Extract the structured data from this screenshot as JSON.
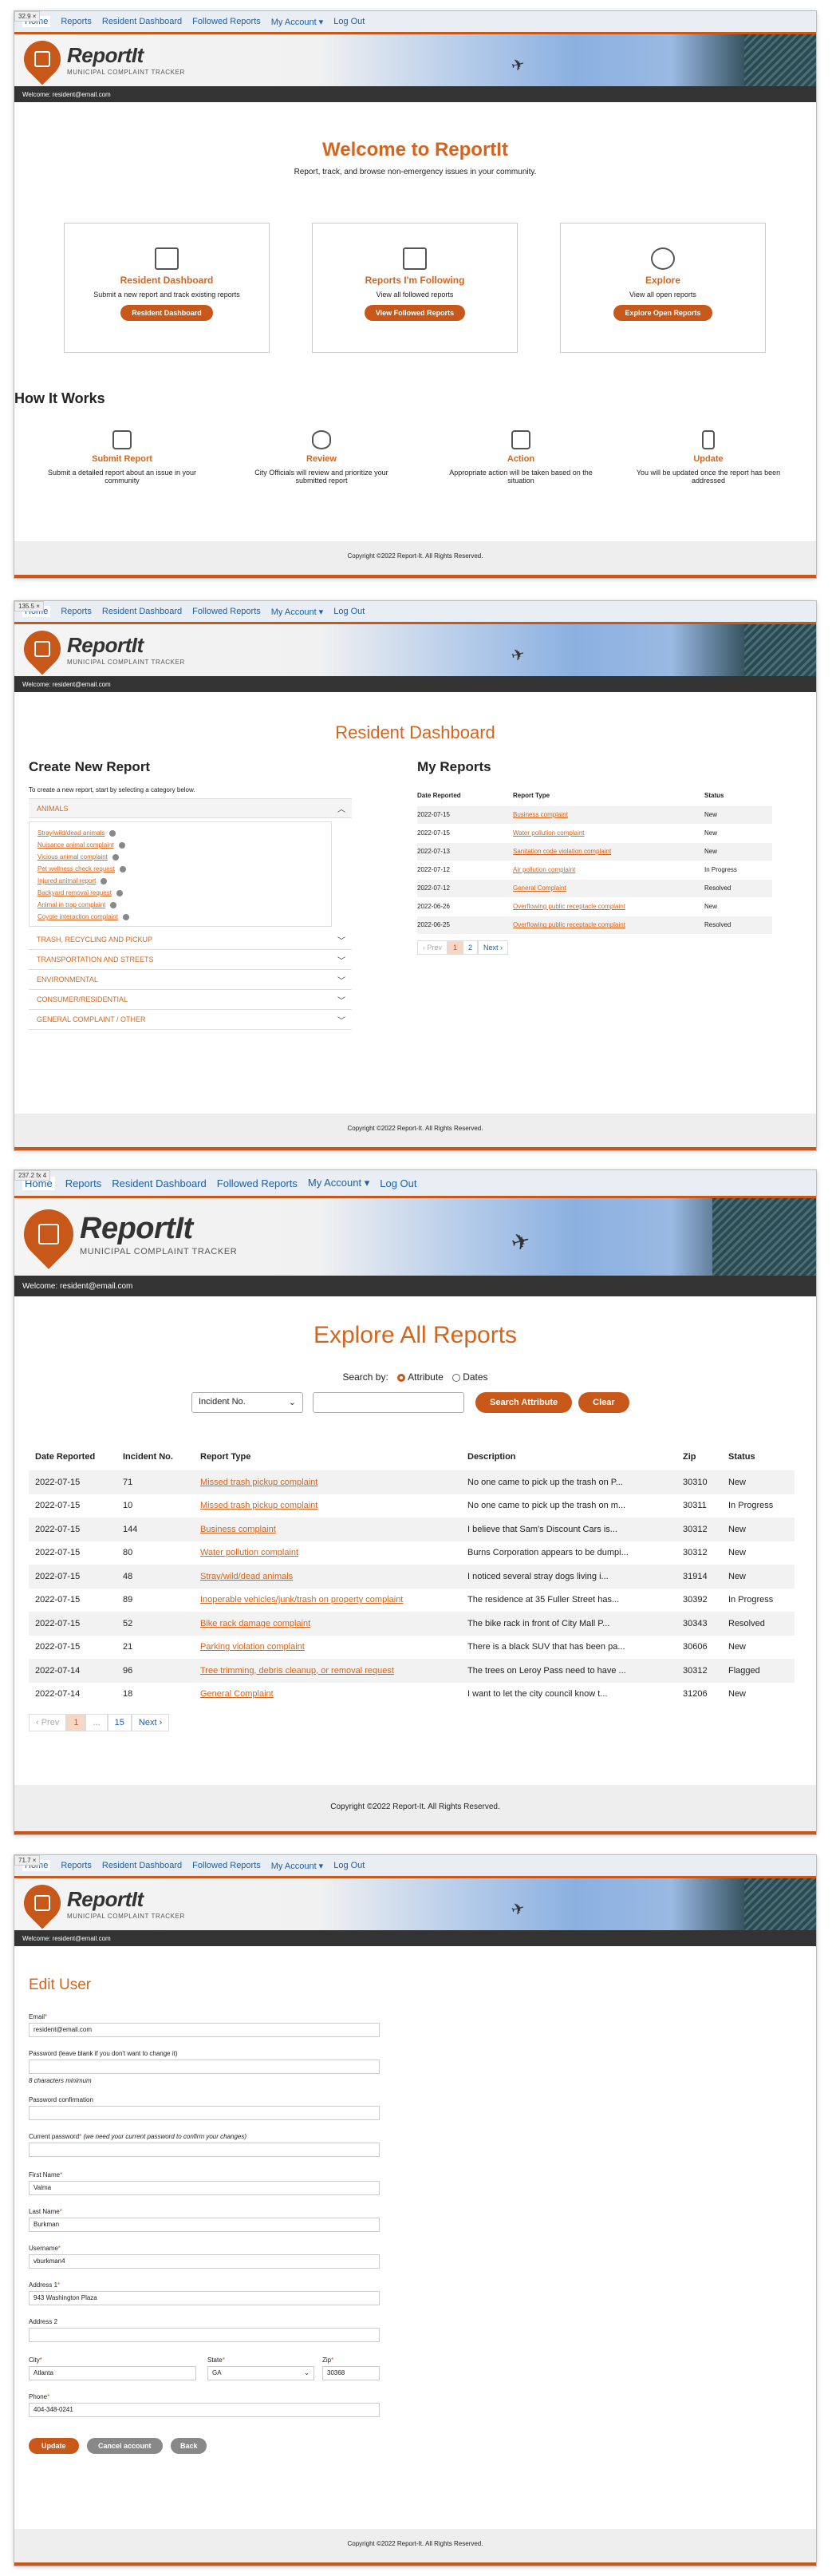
{
  "common": {
    "nav": [
      "Home",
      "Reports",
      "Resident Dashboard",
      "Followed Reports",
      "My Account",
      "Log Out"
    ],
    "logo_title": "ReportIt",
    "logo_subtitle": "MUNICIPAL COMPLAINT TRACKER",
    "welcome": "Welcome: resident@email.com",
    "copyright": "Copyright ©2022 Report-It. All Rights Reserved.",
    "colors": {
      "accent": "#c8581a",
      "link": "#1c5fa8",
      "bar": "#333333"
    }
  },
  "shot_tags": [
    "32.9 ×",
    "135.5 ×",
    "237.2 fx 4",
    "71.7 ×"
  ],
  "home": {
    "title": "Welcome to ReportIt",
    "subtitle": "Report, track, and browse non-emergency issues in your community.",
    "cards": [
      {
        "title": "Resident Dashboard",
        "text": "Submit a new report and track existing reports",
        "button": "Resident Dashboard",
        "icon": "dashboard-icon"
      },
      {
        "title": "Reports I'm Following",
        "text": "View all followed reports",
        "button": "View Followed Reports",
        "icon": "followed-icon"
      },
      {
        "title": "Explore",
        "text": "View all open reports",
        "button": "Explore Open Reports",
        "icon": "compass-icon"
      }
    ],
    "how_title": "How It Works",
    "steps": [
      {
        "title": "Submit Report",
        "text": "Submit a detailed report about an issue in your community",
        "icon": "envelope-icon"
      },
      {
        "title": "Review",
        "text": "City Officials will review and prioritize your submitted report",
        "icon": "eye-icon"
      },
      {
        "title": "Action",
        "text": "Appropriate action will be taken based on the situation",
        "icon": "clipboard-icon"
      },
      {
        "title": "Update",
        "text": "You will be updated once the report has been addressed",
        "icon": "phone-icon"
      }
    ]
  },
  "dashboard": {
    "title": "Resident Dashboard",
    "create_title": "Create New Report",
    "create_intro": "To create a new report, start by selecting a category below.",
    "categories": [
      "ANIMALS",
      "TRASH, RECYCLING AND PICKUP",
      "TRANSPORTATION AND STREETS",
      "ENVIRONMENTAL",
      "CONSUMER/RESIDENTIAL",
      "GENERAL COMPLAINT / OTHER"
    ],
    "animal_items": [
      "Stray/wild/dead animals",
      "Nuisance animal complaint",
      "Vicious animal complaint",
      "Pet wellness check request",
      "Injured animal report",
      "Backyard removal request",
      "Animal in trap complaint",
      "Coyote interaction complaint"
    ],
    "my_reports_title": "My Reports",
    "headers": [
      "Date Reported",
      "Report Type",
      "Status"
    ],
    "rows": [
      [
        "2022-07-15",
        "Business complaint",
        "New"
      ],
      [
        "2022-07-15",
        "Water pollution complaint",
        "New"
      ],
      [
        "2022-07-13",
        "Sanitation code violation complaint",
        "New"
      ],
      [
        "2022-07-12",
        "Air pollution complaint",
        "In Progress"
      ],
      [
        "2022-07-12",
        "General Complaint",
        "Resolved"
      ],
      [
        "2022-06-26",
        "Overflowing public receptacle complaint",
        "New"
      ],
      [
        "2022-06-25",
        "Overflowing public receptacle complaint",
        "Resolved"
      ]
    ],
    "pagination": [
      "‹ Prev",
      "1",
      "2",
      "Next ›"
    ]
  },
  "explore": {
    "title": "Explore All Reports",
    "search_by": "Search by:",
    "radio_attr": "Attribute",
    "radio_dates": "Dates",
    "select_value": "Incident No.",
    "search_button": "Search Attribute",
    "clear_button": "Clear",
    "headers": [
      "Date Reported",
      "Incident No.",
      "Report Type",
      "Description",
      "Zip",
      "Status"
    ],
    "rows": [
      [
        "2022-07-15",
        "71",
        "Missed trash pickup complaint",
        "No one came to pick up the trash on P...",
        "30310",
        "New"
      ],
      [
        "2022-07-15",
        "10",
        "Missed trash pickup complaint",
        "No one came to pick up the trash on m...",
        "30311",
        "In Progress"
      ],
      [
        "2022-07-15",
        "144",
        "Business complaint",
        "I believe that Sam's Discount Cars is...",
        "30312",
        "New"
      ],
      [
        "2022-07-15",
        "80",
        "Water pollution complaint",
        "Burns Corporation appears to be dumpi...",
        "30312",
        "New"
      ],
      [
        "2022-07-15",
        "48",
        "Stray/wild/dead animals",
        "I noticed several stray dogs living i...",
        "31914",
        "New"
      ],
      [
        "2022-07-15",
        "89",
        "Inoperable vehicles/junk/trash on property complaint",
        "The residence at 35 Fuller Street has...",
        "30392",
        "In Progress"
      ],
      [
        "2022-07-15",
        "52",
        "Bike rack damage complaint",
        "The bike rack in front of City Mall P...",
        "30343",
        "Resolved"
      ],
      [
        "2022-07-15",
        "21",
        "Parking violation complaint",
        "There is a black SUV that has been pa...",
        "30606",
        "New"
      ],
      [
        "2022-07-14",
        "96",
        "Tree trimming, debris cleanup, or removal request",
        "The trees on Leroy Pass need to have ...",
        "30312",
        "Flagged"
      ],
      [
        "2022-07-14",
        "18",
        "General Complaint",
        "I want to let the city council know t...",
        "31206",
        "New"
      ]
    ],
    "pagination": [
      "‹ Prev",
      "1",
      "...",
      "15",
      "Next ›"
    ]
  },
  "edit": {
    "title": "Edit User",
    "email_label": "Email",
    "email": "resident@email.com",
    "password_label": "Password (leave blank if you don't want to change it)",
    "password_hint": "8 characters minimum",
    "confirm_label": "Password confirmation",
    "current_label": "Current password",
    "current_hint": "(we need your current password to confirm your changes)",
    "first_label": "First Name",
    "first": "Valma",
    "last_label": "Last Name",
    "last": "Burkman",
    "user_label": "Username",
    "user": "vburkman4",
    "addr1_label": "Address 1",
    "addr1": "943 Washington Plaza",
    "addr2_label": "Address 2",
    "city_label": "City",
    "city": "Atlanta",
    "state_label": "State",
    "state": "GA",
    "zip_label": "Zip",
    "zip": "30368",
    "phone_label": "Phone",
    "phone": "404-348-0241",
    "update": "Update",
    "cancel": "Cancel account",
    "back": "Back"
  }
}
